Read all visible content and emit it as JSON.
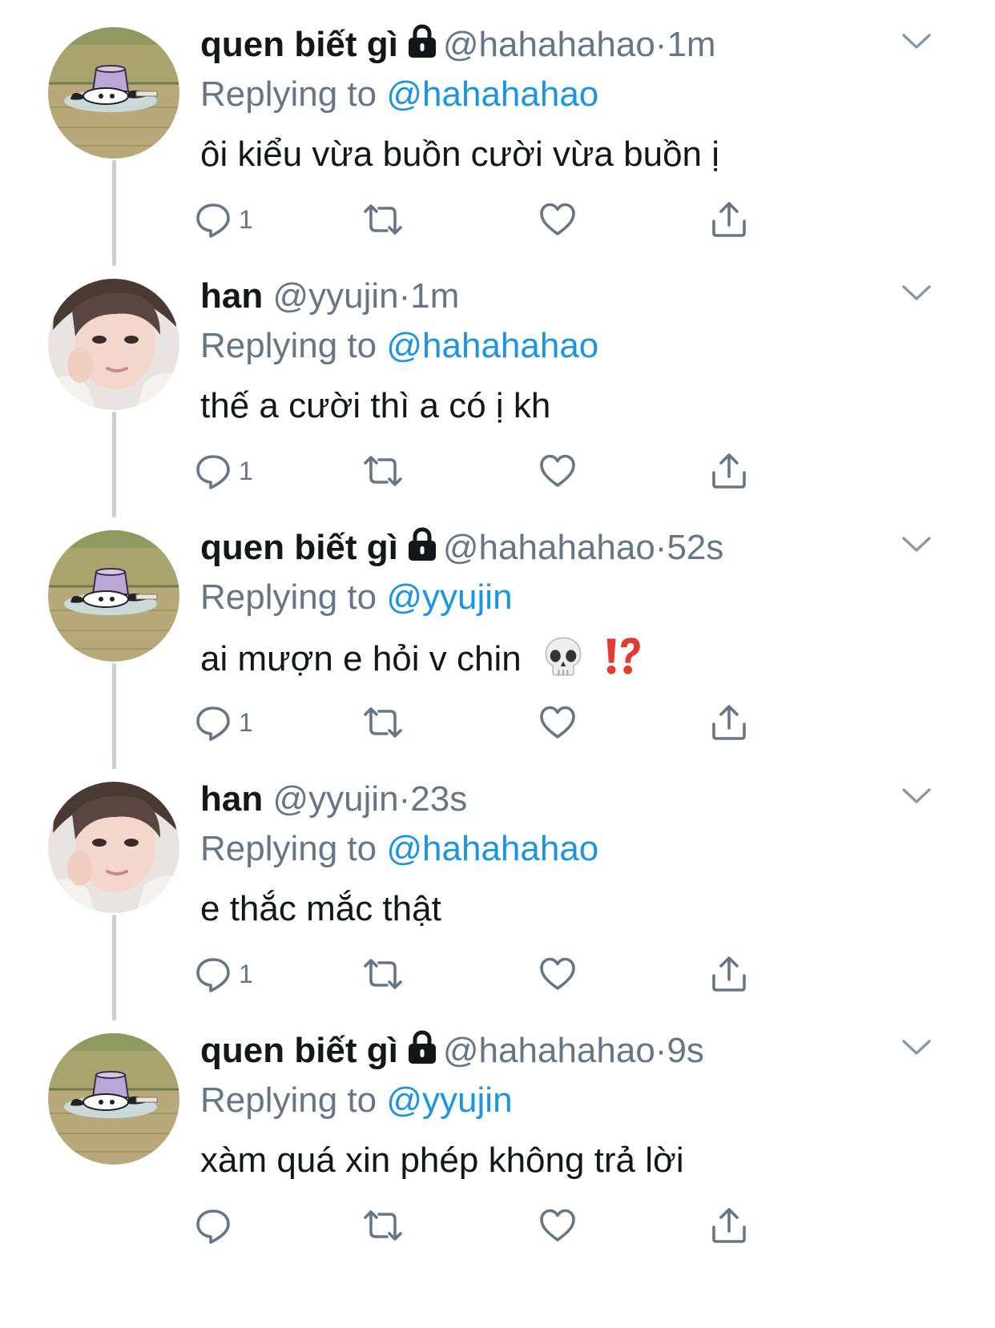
{
  "colors": {
    "accent": "#1b95e0",
    "muted": "#657786",
    "text": "#14171a",
    "thread": "#c4cfd6"
  },
  "tweets": [
    {
      "name": "quen biết gì",
      "locked": true,
      "handle": "@hahahahao",
      "sep": "·",
      "time": "1m",
      "replying_prefix": "Replying to",
      "replying_to": "@hahahahao",
      "text": "ôi kiểu vừa buồn cười vừa buồn ị",
      "reply_count": "1",
      "avatar": "kuromi-avatar"
    },
    {
      "name": "han",
      "locked": false,
      "handle": "@yyujin",
      "sep": "·",
      "time": "1m",
      "replying_prefix": "Replying to",
      "replying_to": "@hahahahao",
      "text": "thế a cười thì a có ị kh",
      "reply_count": "1",
      "avatar": "person-avatar"
    },
    {
      "name": "quen biết gì",
      "locked": true,
      "handle": "@hahahahao",
      "sep": "·",
      "time": "52s",
      "replying_prefix": "Replying to",
      "replying_to": "@yyujin",
      "text": "ai mượn e hỏi v chin",
      "emojis": [
        "skull-icon",
        "interrobang-icon"
      ],
      "reply_count": "1",
      "avatar": "kuromi-avatar"
    },
    {
      "name": "han",
      "locked": false,
      "handle": "@yyujin",
      "sep": "·",
      "time": "23s",
      "replying_prefix": "Replying to",
      "replying_to": "@hahahahao",
      "text": "e thắc mắc thật",
      "reply_count": "1",
      "avatar": "person-avatar"
    },
    {
      "name": "quen biết gì",
      "locked": true,
      "handle": "@hahahahao",
      "sep": "·",
      "time": "9s",
      "replying_prefix": "Replying to",
      "replying_to": "@yyujin",
      "text": "xàm quá xin phép không trả lời",
      "reply_count": "",
      "avatar": "kuromi-avatar"
    }
  ]
}
